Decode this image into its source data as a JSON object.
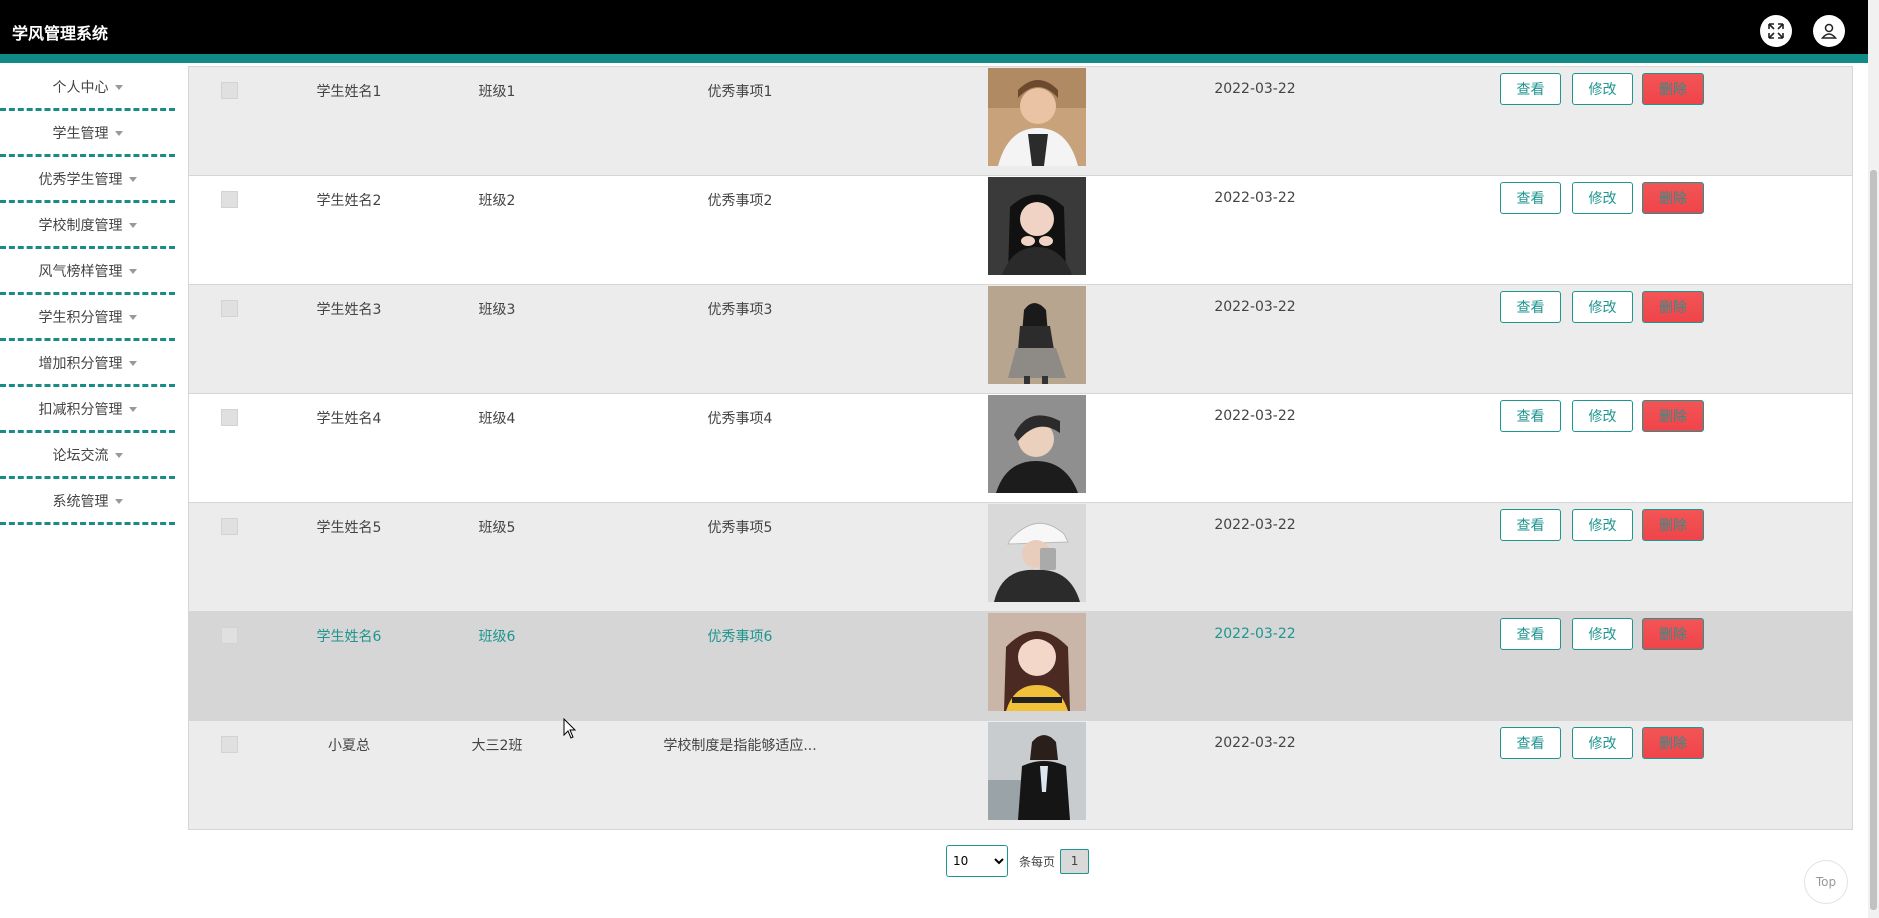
{
  "app": {
    "title": "学风管理系统"
  },
  "header": {
    "fullscreen_icon": "expand-icon",
    "user_icon": "user-icon"
  },
  "sidebar": {
    "items": [
      {
        "label": "个人中心"
      },
      {
        "label": "学生管理"
      },
      {
        "label": "优秀学生管理"
      },
      {
        "label": "学校制度管理"
      },
      {
        "label": "风气榜样管理"
      },
      {
        "label": "学生积分管理"
      },
      {
        "label": "增加积分管理"
      },
      {
        "label": "扣减积分管理"
      },
      {
        "label": "论坛交流"
      },
      {
        "label": "系统管理"
      }
    ]
  },
  "table": {
    "rows": [
      {
        "name": "学生姓名1",
        "class": "班级1",
        "item": "优秀事项1",
        "date": "2022-03-22",
        "photo": "student-photo-1"
      },
      {
        "name": "学生姓名2",
        "class": "班级2",
        "item": "优秀事项2",
        "date": "2022-03-22",
        "photo": "student-photo-2"
      },
      {
        "name": "学生姓名3",
        "class": "班级3",
        "item": "优秀事项3",
        "date": "2022-03-22",
        "photo": "student-photo-3"
      },
      {
        "name": "学生姓名4",
        "class": "班级4",
        "item": "优秀事项4",
        "date": "2022-03-22",
        "photo": "student-photo-4"
      },
      {
        "name": "学生姓名5",
        "class": "班级5",
        "item": "优秀事项5",
        "date": "2022-03-22",
        "photo": "student-photo-5"
      },
      {
        "name": "学生姓名6",
        "class": "班级6",
        "item": "优秀事项6",
        "date": "2022-03-22",
        "photo": "student-photo-6"
      },
      {
        "name": "小夏总",
        "class": "大三2班",
        "item": "学校制度是指能够适应...",
        "date": "2022-03-22",
        "photo": "student-photo-7"
      }
    ],
    "actions": {
      "view": "查看",
      "edit": "修改",
      "delete": "删除"
    }
  },
  "pagination": {
    "page_size": "10",
    "per_page_label": "条每页",
    "current_page": "1"
  },
  "top_button": {
    "label": "Top"
  },
  "colors": {
    "accent": "#1e958f",
    "header_bg": "#000000",
    "delete_bg": "#f0444a"
  }
}
